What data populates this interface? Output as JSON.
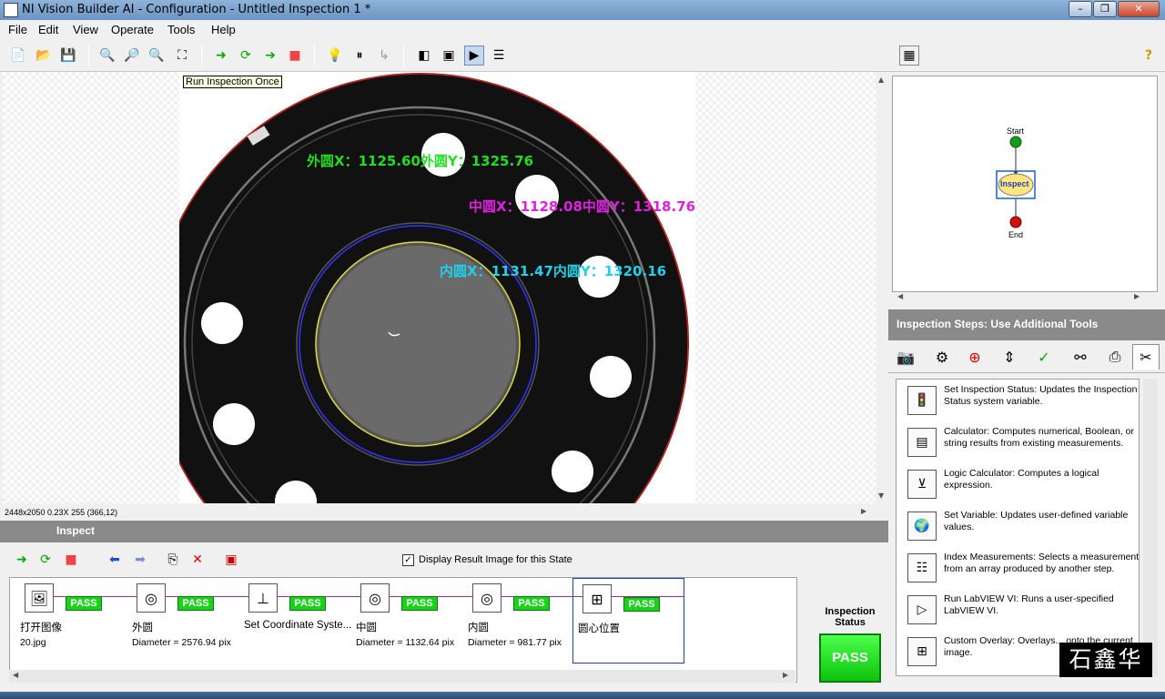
{
  "window": {
    "title": "NI Vision Builder AI - Configuration - Untitled Inspection 1 *"
  },
  "menu": [
    "File",
    "Edit",
    "View",
    "Operate",
    "Tools",
    "Help"
  ],
  "viewer": {
    "tooltip": "Run Inspection Once",
    "status_line": "2448x2050 0.23X 255    (366,12)",
    "overlays": [
      {
        "text": "外圆X：1125.60外圆Y：1325.76",
        "color": "#22dd22"
      },
      {
        "text": "中圆X：1128.08中圆Y：1318.76",
        "color": "#e020e0"
      },
      {
        "text": "内圆X：1131.47内圆Y：1320.16",
        "color": "#20d0e8"
      }
    ]
  },
  "flow": {
    "start": "Start",
    "state": "Inspect",
    "end": "End"
  },
  "steps_panel": {
    "title": "Inspection Steps: Use Additional Tools",
    "tools": [
      {
        "icon": "traffic-light-icon",
        "name": "Set Inspection Status:",
        "desc": "Updates the Inspection Status system variable."
      },
      {
        "icon": "calculator-icon",
        "name": "Calculator:",
        "desc": "Computes numerical, Boolean, or string results from existing measurements."
      },
      {
        "icon": "logic-icon",
        "name": "Logic Calculator:",
        "desc": "Computes a logical expression."
      },
      {
        "icon": "globe-icon",
        "name": "Set Variable:",
        "desc": "Updates user-defined variable values."
      },
      {
        "icon": "index-icon",
        "name": "Index Measurements:",
        "desc": "Selects a measurement from an array produced by another step."
      },
      {
        "icon": "labview-icon",
        "name": "Run LabVIEW VI:",
        "desc": "Runs a user-specified LabVIEW VI."
      },
      {
        "icon": "overlay-icon",
        "name": "Custom Overlay:",
        "desc": "Overlays... onto the current image."
      }
    ]
  },
  "inspect_panel": {
    "title": "Inspect",
    "display_result_label": "Display Result Image for this State",
    "steps": [
      {
        "name": "打开图像",
        "result": "20.jpg",
        "status": "PASS",
        "icon": "open-image-icon"
      },
      {
        "name": "外圆",
        "result": "Diameter = 2576.94 pix",
        "status": "PASS",
        "icon": "circle-detect-icon"
      },
      {
        "name": "Set Coordinate Syste...",
        "result": "",
        "status": "PASS",
        "icon": "coordinate-system-icon"
      },
      {
        "name": "中圆",
        "result": "Diameter = 1132.64 pix",
        "status": "PASS",
        "icon": "circle-detect-icon"
      },
      {
        "name": "内圆",
        "result": "Diameter = 981.77 pix",
        "status": "PASS",
        "icon": "circle-detect-icon"
      },
      {
        "name": "圆心位置",
        "result": "",
        "status": "PASS",
        "icon": "overlay-icon"
      }
    ]
  },
  "inspection_status": {
    "label": "Inspection Status",
    "value": "PASS"
  },
  "watermark": "石鑫华",
  "colors": {
    "pass": "#19d219",
    "panel_header": "#8a8a8a",
    "connector": "#9b2a9b"
  }
}
